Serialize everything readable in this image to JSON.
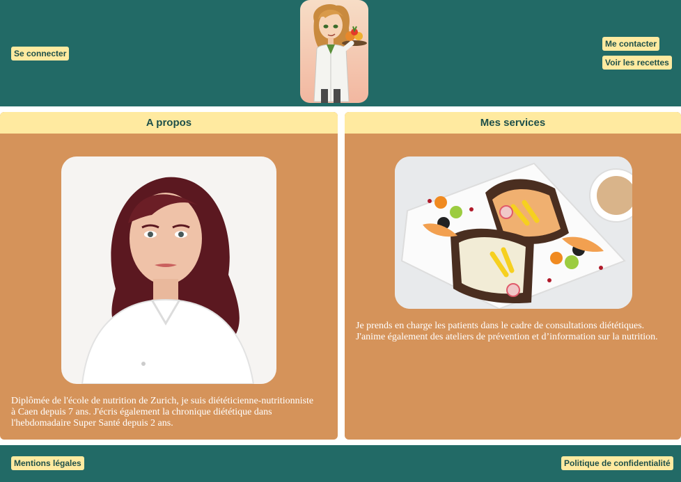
{
  "header": {
    "login_label": "Se connecter",
    "contact_label": "Me contacter",
    "recipes_label": "Voir les recettes"
  },
  "about": {
    "title": "A propos",
    "text": "Diplômée de l'école de nutrition de Zurich, je suis diététicienne-nutritionniste à Caen depuis 7 ans. J'écris également la chronique diététique dans l'hebdomadaire Super Santé depuis 2 ans."
  },
  "services": {
    "title": "Mes services",
    "text": "Je prends en charge les patients dans le cadre de consultations diététiques. J'anime également des ateliers de prévention et d’information sur la nutrition."
  },
  "footer": {
    "legal_label": "Mentions légales",
    "privacy_label": "Politique de confidentialité"
  },
  "colors": {
    "header_bg": "#226a66",
    "button_bg": "#ffeaa0",
    "card_bg": "#d5935a",
    "text_dark": "#1d4f49"
  }
}
